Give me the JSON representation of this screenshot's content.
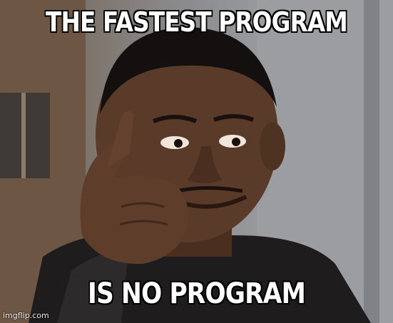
{
  "meme": {
    "top_text": "THE FASTEST PROGRAM",
    "bottom_text": "IS NO PROGRAM",
    "watermark": "imgflip.com"
  },
  "colors": {
    "caption_fill": "#ffffff",
    "caption_outline": "#000000",
    "skin": "#5a3a28",
    "jacket": "#1e1c1d"
  }
}
